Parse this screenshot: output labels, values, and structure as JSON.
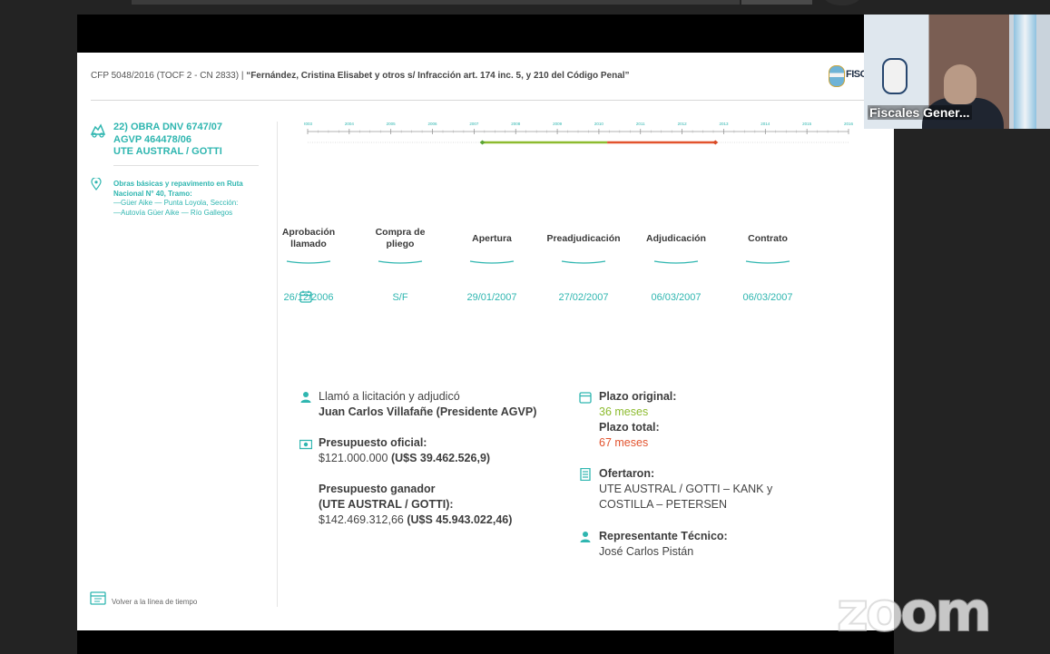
{
  "header": {
    "case_prefix": "CFP 5048/2016 (TOCF 2 - CN 2833) | ",
    "case_title": "“Fernández, Cristina Elisabet y otros s/ Infracción art. 174 inc. 5, y 210 del Código Penal”",
    "logo_text": "FISC"
  },
  "obra": {
    "line1": "22) OBRA DNV 6747/07",
    "line2": "AGVP 464478/06",
    "line3": "UTE AUSTRAL / GOTTI",
    "desc_bold1": "Obras básicas y repavimento en Ruta",
    "desc_bold2": "Nacional N° 40, Tramo:",
    "desc_line3": "—Güer Aike — Punta Loyola, Sección:",
    "desc_line4": "—Autovía Güer Aike — Río Gallegos"
  },
  "timeline": {
    "years": [
      "2003",
      "2004",
      "2005",
      "2006",
      "2007",
      "2008",
      "2009",
      "2010",
      "2011",
      "2012",
      "2013",
      "2014",
      "2015",
      "2016"
    ],
    "original_color": "#8dbb2f",
    "total_color": "#e2532e"
  },
  "steps": [
    {
      "label1": "Aprobación",
      "label2": "llamado",
      "date": "26/12/2006"
    },
    {
      "label1": "Compra de",
      "label2": "pliego",
      "date": "S/F"
    },
    {
      "label1": "Apertura",
      "label2": "",
      "date": "29/01/2007"
    },
    {
      "label1": "Preadjudicación",
      "label2": "",
      "date": "27/02/2007"
    },
    {
      "label1": "Adjudicación",
      "label2": "",
      "date": "06/03/2007"
    },
    {
      "label1": "Contrato",
      "label2": "",
      "date": "06/03/2007"
    }
  ],
  "left_info": {
    "llamo_label": "Llamó a licitación y adjudicó",
    "llamo_name": "Juan Carlos Villafañe (Presidente AGVP)",
    "presupuesto_oficial_label": "Presupuesto oficial:",
    "presupuesto_oficial_ars": "$121.000.000 ",
    "presupuesto_oficial_usd": "(U$S 39.462.526,9)",
    "presupuesto_ganador_label1": "Presupuesto ganador",
    "presupuesto_ganador_label2": "(UTE AUSTRAL / GOTTI):",
    "presupuesto_ganador_ars": "$142.469.312,66 ",
    "presupuesto_ganador_usd": "(U$S 45.943.022,46)"
  },
  "right_info": {
    "plazo_original_label": "Plazo original:",
    "plazo_original_value": "36 meses",
    "plazo_total_label": "Plazo total:",
    "plazo_total_value": "67 meses",
    "ofertaron_label": "Ofertaron:",
    "ofertaron_line1": "UTE AUSTRAL / GOTTI – KANK y",
    "ofertaron_line2": "COSTILLA – PETERSEN",
    "representante_label": "Representante Técnico:",
    "representante_name": "José Carlos Pistán"
  },
  "footer": {
    "back_label": "Volver a la línea de tiempo"
  },
  "video": {
    "participant_name": "Fiscales Gener..."
  },
  "watermark": {
    "text": "zoom"
  }
}
